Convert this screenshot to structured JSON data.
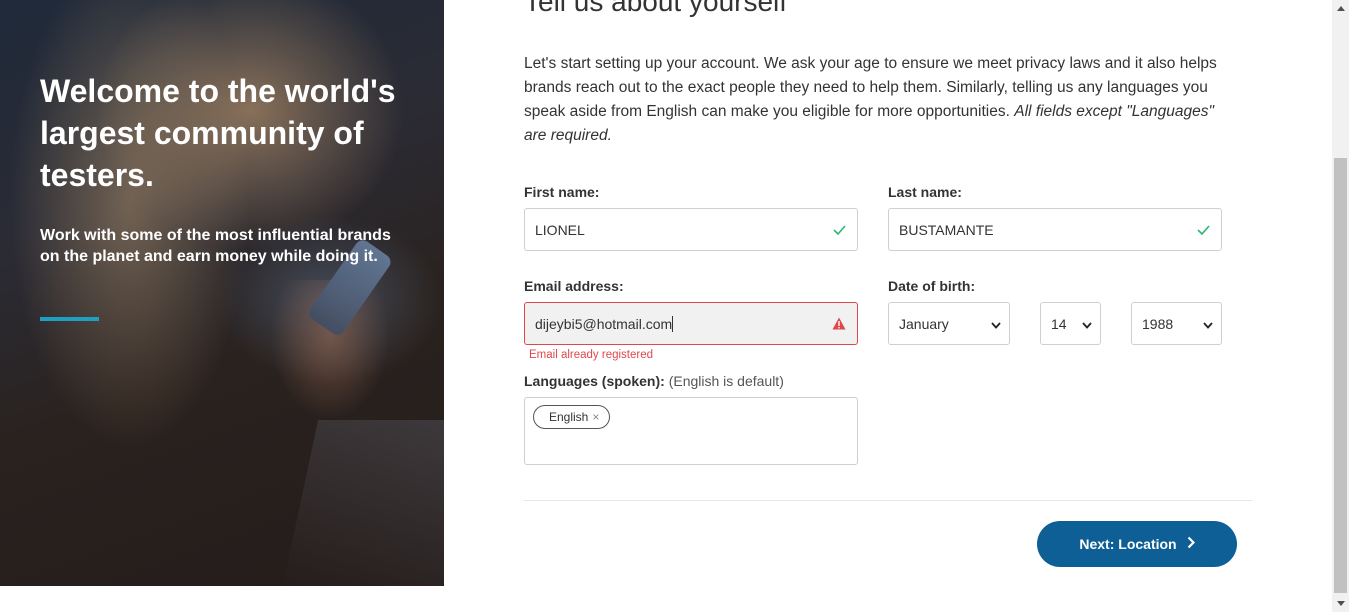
{
  "hero": {
    "title": "Welcome to the world's largest community of testers.",
    "subtitle": "Work with some of the most influential brands on the planet and earn money while doing it."
  },
  "form": {
    "heading": "Tell us about yourself",
    "intro": "Let's start setting up your account. We ask your age to ensure we meet privacy laws and it also helps brands reach out to the exact people they need to help them. Similarly, telling us any languages you speak aside from English can make you eligible for more opportunities.",
    "intro_note": "All fields except \"Languages\" are required.",
    "first_name": {
      "label": "First name:",
      "value": "LIONEL"
    },
    "last_name": {
      "label": "Last name:",
      "value": "BUSTAMANTE"
    },
    "email": {
      "label": "Email address:",
      "value": "dijeybi5@hotmail.com",
      "error": "Email already registered"
    },
    "dob": {
      "label": "Date of birth:",
      "month": "January",
      "day": "14",
      "year": "1988"
    },
    "languages": {
      "label": "Languages (spoken):",
      "note": "(English is default)",
      "chips": [
        "English"
      ]
    },
    "next_label": "Next: Location"
  },
  "colors": {
    "accent": "#1ea0c3",
    "primary_button": "#0d5f96",
    "error": "#e0474c",
    "success": "#2bb673"
  }
}
